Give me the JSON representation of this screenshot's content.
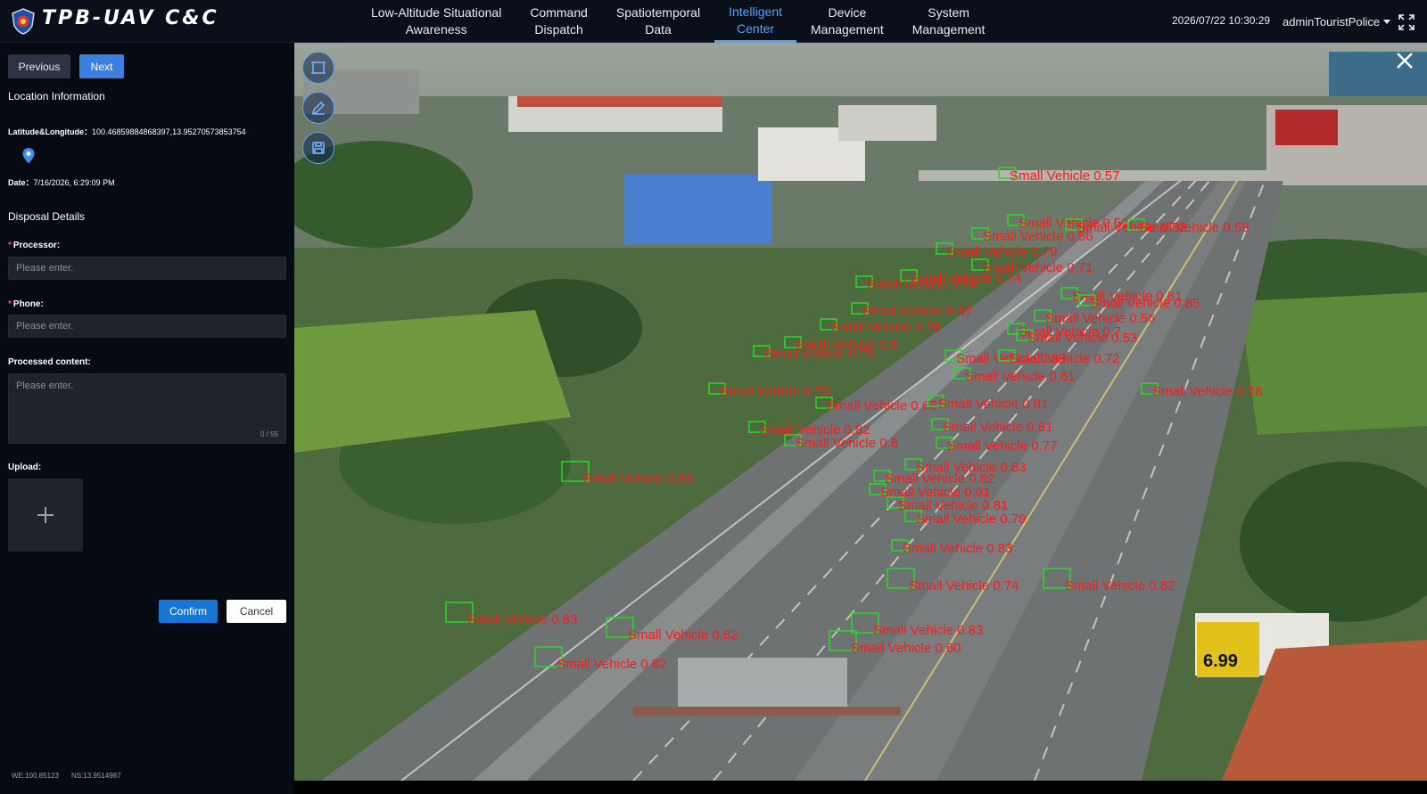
{
  "header": {
    "brand": "TPB-UAV  C&C",
    "nav": [
      {
        "label": "Low-Altitude Situational\nAwareness",
        "active": false
      },
      {
        "label": "Command\nDispatch",
        "active": false
      },
      {
        "label": "Spatiotemporal\nData",
        "active": false
      },
      {
        "label": "Intelligent\nCenter",
        "active": true
      },
      {
        "label": "Device\nManagement",
        "active": false
      },
      {
        "label": "System\nManagement",
        "active": false
      }
    ],
    "datetime": "2026/07/22 10:30:29",
    "user": "adminTouristPolice",
    "icons": [
      "shield-logo-icon",
      "caret-down-icon",
      "fullscreen-icon"
    ]
  },
  "panel": {
    "prev_label": "Previous",
    "next_label": "Next",
    "location_title": "Location Information",
    "latlng_label": "Latitude&Longitude：",
    "latlng_value": "100.46859884868397,13.95270573853754",
    "date_label": "Date：",
    "date_value": "7/16/2026, 6:29:09 PM",
    "disposal_title": "Disposal Details",
    "processor_label": "Processor:",
    "processor_placeholder": "Please enter.",
    "phone_label": "Phone:",
    "phone_placeholder": "Please enter.",
    "content_label": "Processed content:",
    "content_placeholder": "Please enter.",
    "content_counter": "0 / 55",
    "upload_label": "Upload:",
    "confirm_label": "Confirm",
    "cancel_label": "Cancel",
    "coord_we": "WE:100.85123",
    "coord_ns": "NS:13.9514987",
    "icons": [
      "location-pin-icon",
      "plus-icon"
    ]
  },
  "video": {
    "tools": [
      "select-frame-icon",
      "draw-pen-icon",
      "save-icon"
    ],
    "close_icon": "close-icon",
    "detection_color": "#ff1a1a",
    "box_color": "#22dd22",
    "billboard_price": "6.99",
    "detections": [
      {
        "label": "Small Vehicle 0.57"
      },
      {
        "label": "Small Vehicle 0.52"
      },
      {
        "label": "Small Vehicle 0.52"
      },
      {
        "label": "Small Vehicle 0.59"
      },
      {
        "label": "Small Vehicle 0.56"
      },
      {
        "label": "Small Vehicle 0.79"
      },
      {
        "label": "Small Vehicle 0.71"
      },
      {
        "label": "Small Vehicle 0.74"
      },
      {
        "label": "Small Vehicle 0.74"
      },
      {
        "label": "Small Vehicle 0.81"
      },
      {
        "label": "Small Vehicle 0.85"
      },
      {
        "label": "Small Vehicle 0.87"
      },
      {
        "label": "Small Vehicle 0.56"
      },
      {
        "label": "Small Vehicle 0.78"
      },
      {
        "label": "Small Vehicle 0.7"
      },
      {
        "label": "Small Vehicle 0.53"
      },
      {
        "label": "Small Vehicle 0.8"
      },
      {
        "label": "Small Vehicle 0.79"
      },
      {
        "label": "Small Vehicle 0.83"
      },
      {
        "label": "Small Vehicle 0.72"
      },
      {
        "label": "Small Vehicle 0.61"
      },
      {
        "label": "Small Vehicle 0.76"
      },
      {
        "label": "Small Vehicle 0.78"
      },
      {
        "label": "Small Vehicle 0.63"
      },
      {
        "label": "Small Vehicle 0.81"
      },
      {
        "label": "Small Vehicle 0.81"
      },
      {
        "label": "Small Vehicle 0.77"
      },
      {
        "label": "Small Vehicle 0.82"
      },
      {
        "label": "Small Vehicle 0.8"
      },
      {
        "label": "Small Vehicle 0.83"
      },
      {
        "label": "Small Vehicle 0.82"
      },
      {
        "label": "Small Vehicle 0.61"
      },
      {
        "label": "Small Vehicle 0.81"
      },
      {
        "label": "Small Vehicle 0.79"
      },
      {
        "label": "Small Vehicle 0.83"
      },
      {
        "label": "Small Vehicle 0.82"
      },
      {
        "label": "Small Vehicle 0.74"
      },
      {
        "label": "Small Vehicle 0.83"
      },
      {
        "label": "Small Vehicle 0.83"
      },
      {
        "label": "Small Vehicle 0.82"
      },
      {
        "label": "Small Vehicle 0.82"
      },
      {
        "label": "Small Vehicle 0.83"
      },
      {
        "label": "Small Vehicle 0.60"
      }
    ]
  }
}
